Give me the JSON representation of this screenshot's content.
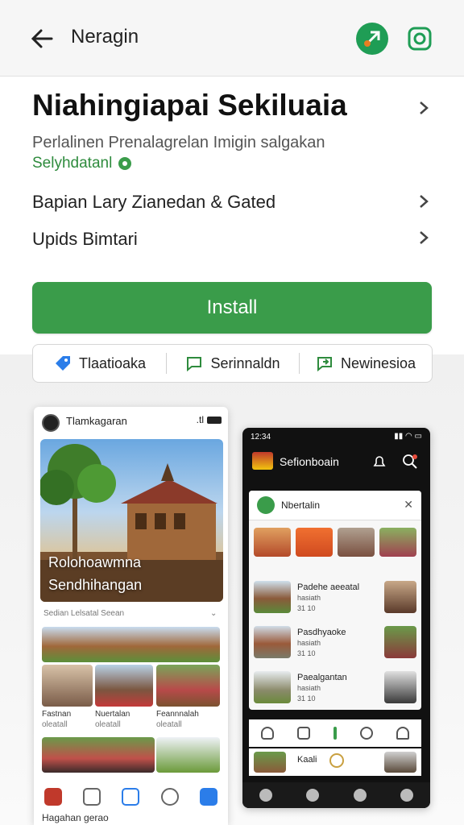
{
  "topbar": {
    "title": "Neragin"
  },
  "app": {
    "title": "Niahingiapai Sekiluaia",
    "subtitle": "Perlalinen Prenalagrelan Imigin salgakan",
    "developer": "Selyhdatanl"
  },
  "rows": [
    {
      "label": "Bapian Lary Zianedan & Gated"
    },
    {
      "label": "Upids Bimtari"
    }
  ],
  "install": {
    "label": "Install"
  },
  "chips": [
    {
      "label": "Tlaatioaka",
      "icon": "tag-icon"
    },
    {
      "label": "Serinnaldn",
      "icon": "chat-icon"
    },
    {
      "label": "Newinesioa",
      "icon": "share-icon"
    }
  ],
  "phone1": {
    "title": "Tlamkagaran",
    "status": ".tl",
    "hero": {
      "line1": "Rolohoawmna",
      "line2": "Sendhihangan"
    },
    "section": "Sedian Lelsatal Seean",
    "captions": [
      "Fastnan",
      "Nuertalan",
      "Feannnalah"
    ],
    "captions2": [
      "oleatall",
      "oleatall",
      "oleatall"
    ],
    "bottom_text": "Hagahan gerao"
  },
  "phone2": {
    "time": "12:34",
    "title": "Sefionboain",
    "card_title": "Nbertalin",
    "items": [
      {
        "title": "Padehe aeeatal",
        "sub": "hasiath",
        "meta": "31 10"
      },
      {
        "title": "Pasdhyaoke",
        "sub": "hasiath",
        "meta": "31 10"
      },
      {
        "title": "Paealgantan",
        "sub": "hasiath",
        "meta": "31 10"
      }
    ],
    "last_item": "Kaali"
  },
  "colors": {
    "accent": "#3a9c4a",
    "dark": "#111111"
  }
}
